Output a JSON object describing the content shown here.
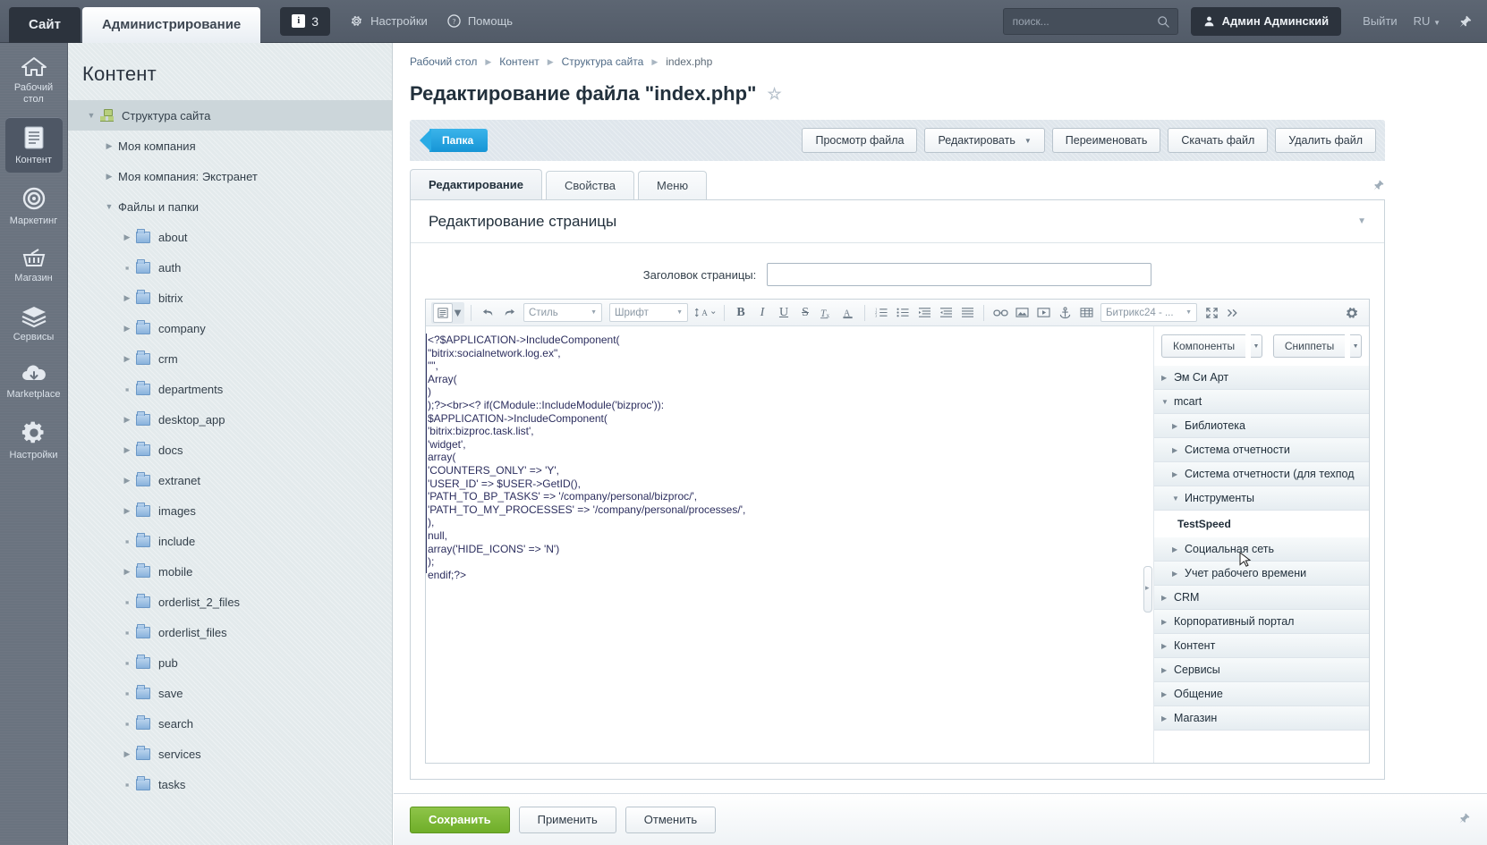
{
  "topbar": {
    "tab_site": "Сайт",
    "tab_admin": "Администрирование",
    "counter_value": "3",
    "counter_icon": "info-icon",
    "settings": "Настройки",
    "help": "Помощь",
    "search_placeholder": "поиск...",
    "search_value": "",
    "user_name": "Админ Админский",
    "logout": "Выйти",
    "language": "RU",
    "pin_icon": "pin-icon"
  },
  "rail": {
    "items": [
      {
        "label": "Рабочий стол",
        "icon": "home-icon",
        "active": false
      },
      {
        "label": "Контент",
        "icon": "document-icon",
        "active": true
      },
      {
        "label": "Маркетинг",
        "icon": "target-icon",
        "active": false
      },
      {
        "label": "Магазин",
        "icon": "basket-icon",
        "active": false
      },
      {
        "label": "Сервисы",
        "icon": "layers-icon",
        "active": false
      },
      {
        "label": "Marketplace",
        "icon": "cloud-download-icon",
        "active": false
      },
      {
        "label": "Настройки",
        "icon": "gear-icon",
        "active": false
      }
    ]
  },
  "tree": {
    "title": "Контент",
    "nodes": [
      {
        "label": "Структура сайта",
        "indent": 0,
        "twisty": "down",
        "icon": "site-structure-icon",
        "selected": true
      },
      {
        "label": "Моя компания",
        "indent": 1,
        "twisty": "right",
        "icon": "none",
        "selected": false
      },
      {
        "label": "Моя компания: Экстранет",
        "indent": 1,
        "twisty": "right",
        "icon": "none",
        "selected": false
      },
      {
        "label": "Файлы и папки",
        "indent": 1,
        "twisty": "down",
        "icon": "none",
        "selected": false
      },
      {
        "label": "about",
        "indent": 2,
        "twisty": "right",
        "icon": "folder-icon",
        "selected": false
      },
      {
        "label": "auth",
        "indent": 2,
        "twisty": "dot",
        "icon": "folder-icon",
        "selected": false
      },
      {
        "label": "bitrix",
        "indent": 2,
        "twisty": "right",
        "icon": "folder-icon",
        "selected": false
      },
      {
        "label": "company",
        "indent": 2,
        "twisty": "right",
        "icon": "folder-icon",
        "selected": false
      },
      {
        "label": "crm",
        "indent": 2,
        "twisty": "right",
        "icon": "folder-icon",
        "selected": false
      },
      {
        "label": "departments",
        "indent": 2,
        "twisty": "dot",
        "icon": "folder-icon",
        "selected": false
      },
      {
        "label": "desktop_app",
        "indent": 2,
        "twisty": "right",
        "icon": "folder-icon",
        "selected": false
      },
      {
        "label": "docs",
        "indent": 2,
        "twisty": "right",
        "icon": "folder-icon",
        "selected": false
      },
      {
        "label": "extranet",
        "indent": 2,
        "twisty": "right",
        "icon": "folder-icon",
        "selected": false
      },
      {
        "label": "images",
        "indent": 2,
        "twisty": "right",
        "icon": "folder-icon",
        "selected": false
      },
      {
        "label": "include",
        "indent": 2,
        "twisty": "dot",
        "icon": "folder-icon",
        "selected": false
      },
      {
        "label": "mobile",
        "indent": 2,
        "twisty": "right",
        "icon": "folder-icon",
        "selected": false
      },
      {
        "label": "orderlist_2_files",
        "indent": 2,
        "twisty": "dot",
        "icon": "folder-icon",
        "selected": false
      },
      {
        "label": "orderlist_files",
        "indent": 2,
        "twisty": "dot",
        "icon": "folder-icon",
        "selected": false
      },
      {
        "label": "pub",
        "indent": 2,
        "twisty": "dot",
        "icon": "folder-icon",
        "selected": false
      },
      {
        "label": "save",
        "indent": 2,
        "twisty": "dot",
        "icon": "folder-icon",
        "selected": false
      },
      {
        "label": "search",
        "indent": 2,
        "twisty": "dot",
        "icon": "folder-icon",
        "selected": false
      },
      {
        "label": "services",
        "indent": 2,
        "twisty": "right",
        "icon": "folder-icon",
        "selected": false
      },
      {
        "label": "tasks",
        "indent": 2,
        "twisty": "dot",
        "icon": "folder-icon",
        "selected": false
      }
    ]
  },
  "main": {
    "breadcrumbs": [
      "Рабочий стол",
      "Контент",
      "Структура сайта",
      "index.php"
    ],
    "page_title": "Редактирование файла \"index.php\"",
    "favorite_icon": "star-icon",
    "flag_label": "Папка",
    "buttons": [
      {
        "label": "Просмотр файла",
        "caret": false
      },
      {
        "label": "Редактировать",
        "caret": true
      },
      {
        "label": "Переименовать",
        "caret": false
      },
      {
        "label": "Скачать файл",
        "caret": false
      },
      {
        "label": "Удалить файл",
        "caret": false
      }
    ],
    "tabs": [
      {
        "label": "Редактирование",
        "active": true
      },
      {
        "label": "Свойства",
        "active": false
      },
      {
        "label": "Меню",
        "active": false
      }
    ],
    "tabs_pin_icon": "pin-icon",
    "panel_title": "Редактирование страницы",
    "panel_collapse_icon": "chevron-down-icon",
    "field_label": "Заголовок страницы:",
    "field_value": "",
    "footer": {
      "save": "Сохранить",
      "apply": "Применить",
      "cancel": "Отменить",
      "pin_icon": "pin-icon"
    }
  },
  "editor": {
    "toolbar": {
      "view_mode_icon": "source-view-icon",
      "undo_icon": "undo-icon",
      "redo_icon": "redo-icon",
      "style_select": "Стиль",
      "font_select": "Шрифт",
      "font_size_icon": "font-size-icon",
      "bold": "B",
      "italic": "I",
      "underline": "U",
      "strike": "S",
      "clear_format_icon": "clear-format-icon",
      "text_color_icon": "text-color-icon",
      "ordered_list_icon": "ordered-list-icon",
      "unordered_list_icon": "unordered-list-icon",
      "indent_icon": "indent-icon",
      "outdent_icon": "outdent-icon",
      "align_icon": "align-justify-icon",
      "link_icon": "link-icon",
      "image_icon": "image-icon",
      "video_icon": "video-icon",
      "anchor_icon": "anchor-icon",
      "table_icon": "table-icon",
      "template_select": "Битрикс24 - ...",
      "fullscreen_icon": "fullscreen-icon",
      "more_icon": "chevron-double-right-icon"
    },
    "code": "<?$APPLICATION->IncludeComponent(\n\"bitrix:socialnetwork.log.ex\",\n\"\",\nArray(\n)\n);?><br><? if(CModule::IncludeModule('bizproc')):\n$APPLICATION->IncludeComponent(\n'bitrix:bizproc.task.list',\n'widget',\narray(\n'COUNTERS_ONLY' => 'Y',\n'USER_ID' => $USER->GetID(),\n'PATH_TO_BP_TASKS' => '/company/personal/bizproc/',\n'PATH_TO_MY_PROCESSES' => '/company/personal/processes/',\n),\nnull,\narray('HIDE_ICONS' => 'N')\n);\nendif;?>"
  },
  "components_panel": {
    "components_button": "Компоненты",
    "snippets_button": "Сниппеты",
    "rows": [
      {
        "label": "Эм Си Арт",
        "level": 1,
        "twisty": "right",
        "leaf": false
      },
      {
        "label": "mcart",
        "level": 1,
        "twisty": "down",
        "leaf": false
      },
      {
        "label": "Библиотека",
        "level": 2,
        "twisty": "right",
        "leaf": false
      },
      {
        "label": "Система отчетности",
        "level": 2,
        "twisty": "right",
        "leaf": false
      },
      {
        "label": "Система отчетности (для техпод",
        "level": 2,
        "twisty": "right",
        "leaf": false
      },
      {
        "label": "Инструменты",
        "level": 2,
        "twisty": "down",
        "leaf": false
      },
      {
        "label": "TestSpeed",
        "level": 3,
        "twisty": "none",
        "leaf": true
      },
      {
        "label": "Социальная сеть",
        "level": 2,
        "twisty": "right",
        "leaf": false
      },
      {
        "label": "Учет рабочего времени",
        "level": 2,
        "twisty": "right",
        "leaf": false
      },
      {
        "label": "CRM",
        "level": 1,
        "twisty": "right",
        "leaf": false
      },
      {
        "label": "Корпоративный портал",
        "level": 1,
        "twisty": "right",
        "leaf": false
      },
      {
        "label": "Контент",
        "level": 1,
        "twisty": "right",
        "leaf": false
      },
      {
        "label": "Сервисы",
        "level": 1,
        "twisty": "right",
        "leaf": false
      },
      {
        "label": "Общение",
        "level": 1,
        "twisty": "right",
        "leaf": false
      },
      {
        "label": "Магазин",
        "level": 1,
        "twisty": "right",
        "leaf": false
      }
    ]
  },
  "colors": {
    "topbar_bg": "#555e6b",
    "rail_bg": "#6a737f",
    "tree_bg": "#e3eaec",
    "accent_blue": "#1ea2e0",
    "save_green": "#6fae29",
    "code_text": "#2c2e5e"
  }
}
